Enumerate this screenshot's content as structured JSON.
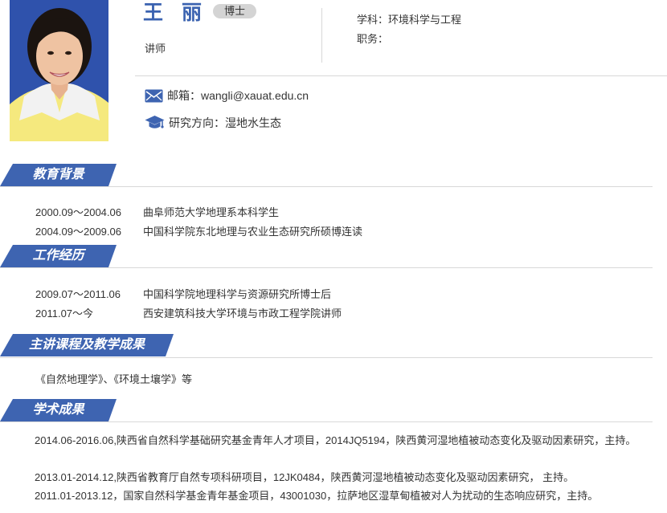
{
  "profile": {
    "name": "王 丽",
    "degree": "博士",
    "title": "讲师",
    "discipline": "学科：环境科学与工程",
    "position": "职务：",
    "email": "邮箱：wangli@xauat.edu.cn",
    "research": "研究方向：湿地水生态"
  },
  "sections": {
    "education": {
      "heading": "教育背景",
      "items": [
        {
          "period": "2000.09～2004.06",
          "detail": "曲阜师范大学地理系本科学生"
        },
        {
          "period": "2004.09～2009.06",
          "detail": "中国科学院东北地理与农业生态研究所硕博连读"
        }
      ]
    },
    "work": {
      "heading": "工作经历",
      "items": [
        {
          "period": "2009.07～2011.06",
          "detail": "中国科学院地理科学与资源研究所博士后"
        },
        {
          "period": "2011.07～今",
          "detail": "西安建筑科技大学环境与市政工程学院讲师"
        }
      ]
    },
    "teaching": {
      "heading": "主讲课程及教学成果",
      "text": "《自然地理学》、《环境土壤学》等"
    },
    "research": {
      "heading": "学术成果",
      "items": [
        "2014.06-2016.06,陕西省自然科学基础研究基金青年人才项目，2014JQ5194，陕西黄河湿地植被动态变化及驱动因素研究，主持。",
        "2013.01-2014.12,陕西省教育厅自然专项科研项目，12JK0484，陕西黄河湿地植被动态变化及驱动因素研究， 主持。",
        "2011.01-2013.12，国家自然科学基金青年基金项目，43001030，拉萨地区湿草甸植被对人为扰动的生态响应研究，主持。"
      ]
    }
  },
  "colors": {
    "accent": "#3e64b1",
    "name": "#3a62b0",
    "badge": "#d4d4d4"
  },
  "icons": {
    "email": "envelope-icon",
    "research": "graduation-cap-icon"
  }
}
